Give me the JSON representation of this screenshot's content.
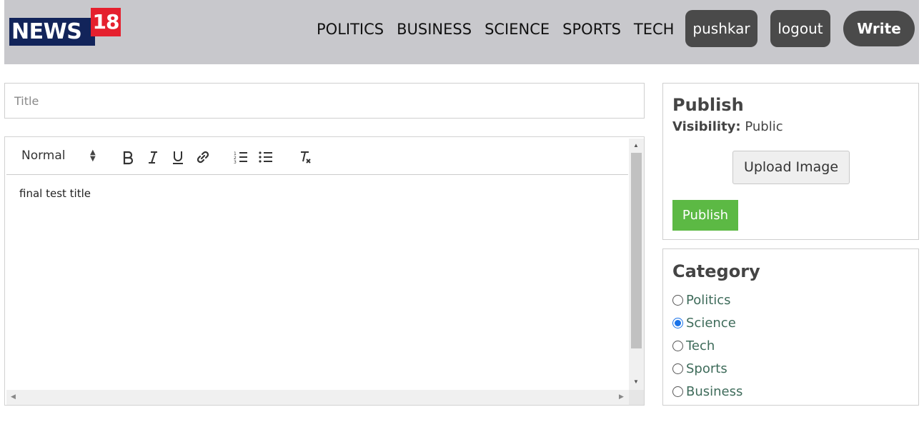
{
  "logo": {
    "text": "NEWS",
    "number": "18",
    "navy": "#12245a",
    "red": "#e5202e"
  },
  "nav": {
    "links": [
      "POLITICS",
      "BUSINESS",
      "SCIENCE",
      "SPORTS",
      "TECH"
    ],
    "user_label": "pushkar",
    "logout_label": "logout",
    "write_label": "Write"
  },
  "editor": {
    "title_placeholder": "Title",
    "format_selected": "Normal",
    "content": "final test title",
    "toolbar_icons": [
      "bold-icon",
      "italic-icon",
      "underline-icon",
      "link-icon",
      "ordered-list-icon",
      "bullet-list-icon",
      "clear-format-icon"
    ]
  },
  "publish": {
    "heading": "Publish",
    "visibility_label": "Visibility:",
    "visibility_value": "Public",
    "upload_label": "Upload Image",
    "publish_label": "Publish",
    "publish_color": "#5cb944"
  },
  "category": {
    "heading": "Category",
    "options": [
      {
        "label": "Politics",
        "checked": false
      },
      {
        "label": "Science",
        "checked": true
      },
      {
        "label": "Tech",
        "checked": false
      },
      {
        "label": "Sports",
        "checked": false
      },
      {
        "label": "Business",
        "checked": false
      }
    ]
  }
}
